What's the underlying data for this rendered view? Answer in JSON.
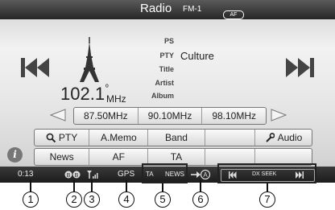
{
  "header": {
    "title": "Radio",
    "band": "FM-1",
    "af_badge": "AF"
  },
  "station": {
    "frequency": "102.1",
    "degree": "º",
    "unit": "MHz"
  },
  "rds": {
    "labels": [
      "PS",
      "PTY",
      "Title",
      "Artist",
      "Album"
    ],
    "pty_value": "Culture"
  },
  "presets": [
    "87.50MHz",
    "90.10MHz",
    "98.10MHz"
  ],
  "row1": {
    "pty": "PTY",
    "amemo": "A.Memo",
    "band": "Band",
    "audio": "Audio"
  },
  "row2": {
    "news": "News",
    "af": "AF",
    "ta": "TA"
  },
  "info_icon": "i",
  "status": {
    "time": "0:13",
    "gps": "GPS",
    "ta": "TA",
    "news": "NEWS",
    "dx_seek": "DX SEEK"
  },
  "callouts": [
    "1",
    "2",
    "3",
    "4",
    "5",
    "6",
    "7"
  ],
  "colors": {
    "titlebar": "#2e2e2e",
    "status_bar": "#1c1c1c",
    "button_face": "#eeeeee"
  },
  "icons": [
    "prev-track-icon",
    "next-track-icon",
    "radio-tower-icon",
    "search-icon",
    "wrench-icon",
    "info-icon",
    "signal-icon",
    "arrow-a-icon",
    "skip-prev-icon",
    "skip-next-icon"
  ]
}
